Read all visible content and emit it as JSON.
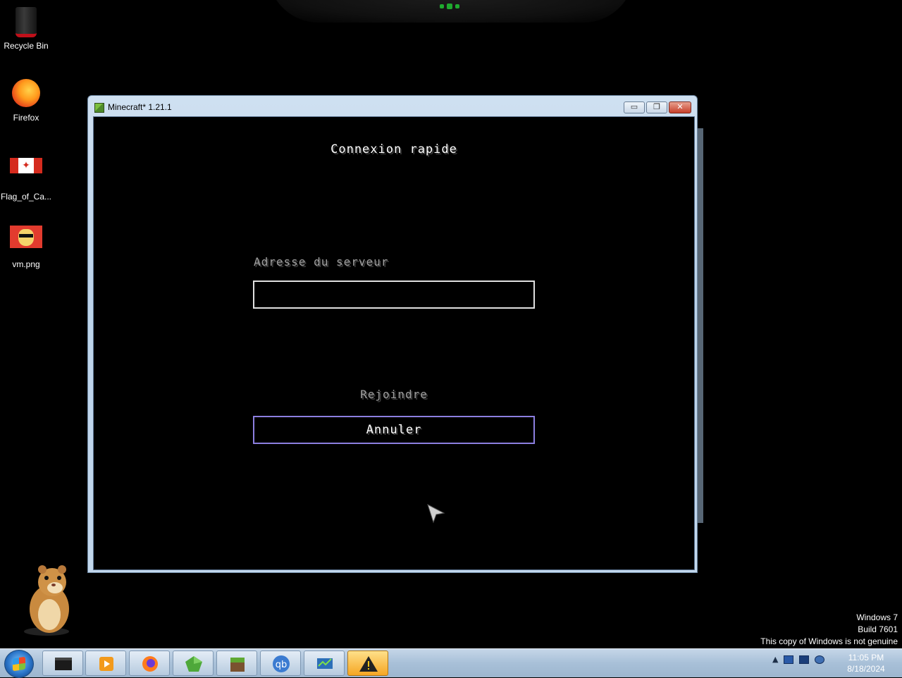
{
  "desktop": {
    "icons": [
      {
        "label": "Recycle Bin"
      },
      {
        "label": "Firefox"
      },
      {
        "label": "Flag_of_Ca..."
      },
      {
        "label": "vm.png"
      }
    ],
    "watermark": {
      "line1": "Windows 7",
      "line2": "Build 7601",
      "line3": "This copy of Windows is not genuine"
    }
  },
  "window": {
    "title": "Minecraft* 1.21.1",
    "buttons": {
      "minimize": "▭",
      "maximize": "❐",
      "close": "✕"
    }
  },
  "screen": {
    "title": "Connexion rapide",
    "address_label": "Adresse du serveur",
    "address_value": "",
    "join_label": "Rejoindre",
    "cancel_label": "Annuler"
  },
  "taskbar": {
    "apps": [
      {
        "icon": "terminal-icon"
      },
      {
        "icon": "media-player-icon"
      },
      {
        "icon": "firefox-icon"
      },
      {
        "icon": "green-gem-icon"
      },
      {
        "icon": "minecraft-icon"
      },
      {
        "icon": "qbittorrent-icon"
      },
      {
        "icon": "monitor-app-icon"
      },
      {
        "icon": "warning-icon"
      }
    ],
    "tray": {
      "show_hidden": "▲"
    },
    "clock": {
      "time": "11:05 PM",
      "date": "8/18/2024"
    }
  },
  "colors": {
    "input_border": "#e0e0e0",
    "cancel_border": "#8c7fe0",
    "label_gray": "#a0a0a0"
  }
}
